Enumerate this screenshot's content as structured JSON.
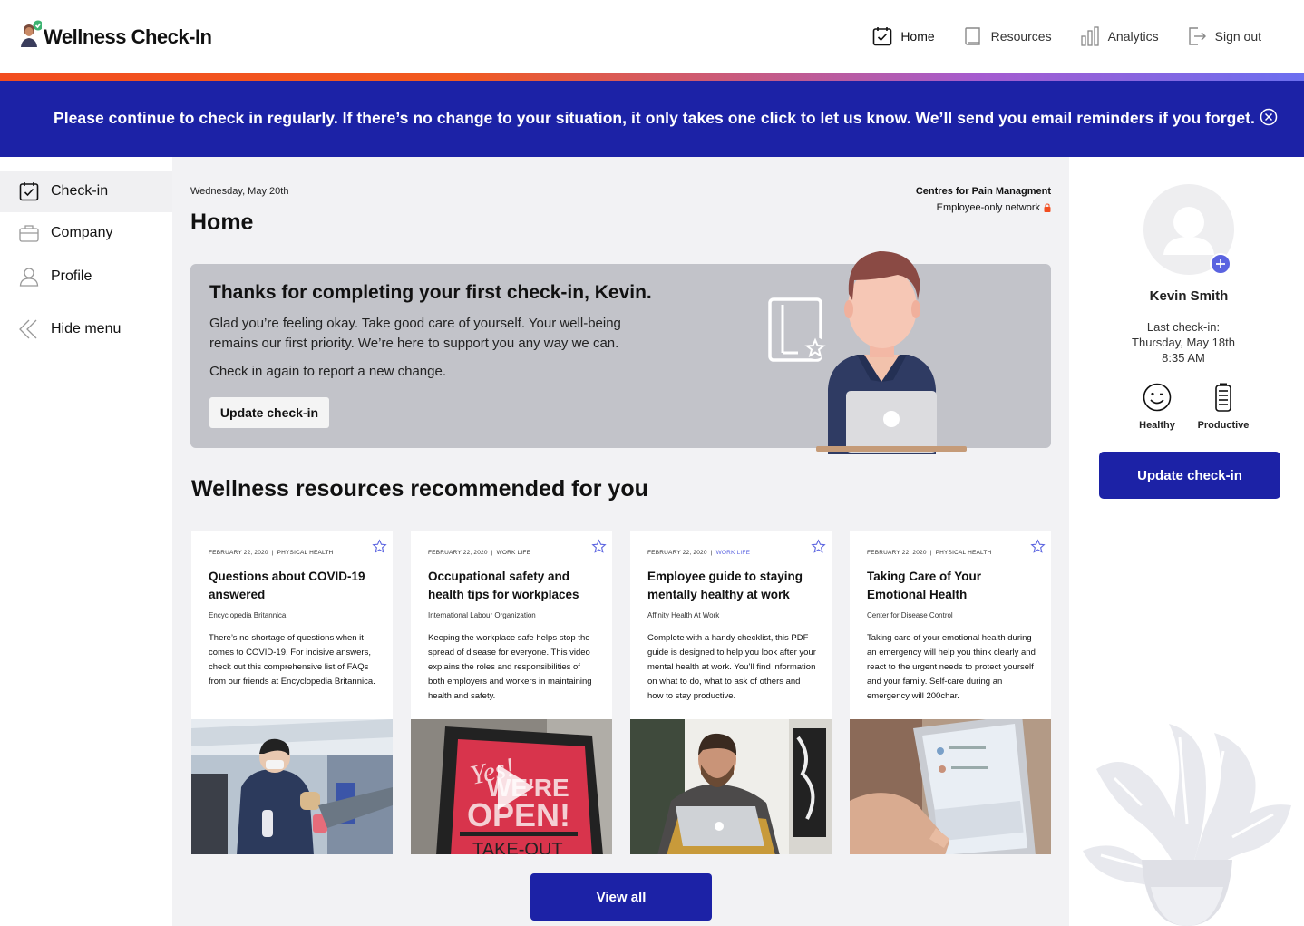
{
  "header": {
    "app_title": "Wellness Check-In",
    "nav": [
      {
        "label": "Home",
        "icon": "calendar-check-icon"
      },
      {
        "label": "Resources",
        "icon": "book-icon"
      },
      {
        "label": "Analytics",
        "icon": "bar-chart-icon"
      },
      {
        "label": "Sign out",
        "icon": "sign-out-icon"
      }
    ]
  },
  "banner": {
    "text": "Please continue to check in regularly. If there’s no change to your situation, it only takes one click to let us know. We’ll send you email reminders if you forget.",
    "color": "#1c22a6"
  },
  "sidebar": {
    "items": [
      {
        "label": "Check-in",
        "icon": "calendar-check-icon"
      },
      {
        "label": "Company",
        "icon": "briefcase-icon"
      },
      {
        "label": "Profile",
        "icon": "user-icon"
      },
      {
        "label": "Hide menu",
        "icon": "double-chevron-left-icon"
      }
    ]
  },
  "main": {
    "date": "Wednesday, May 20th",
    "title": "Home",
    "org_name": "Centres for Pain Managment",
    "network": "Employee-only network",
    "hero": {
      "title": "Thanks for completing your first check-in, Kevin.",
      "text": "Glad you’re feeling okay. Take good care of yourself. Your well-being remains our first priority. We’re here to support you any way we can.",
      "text2": "Check in again to report a new change.",
      "button": "Update check-in"
    },
    "section_title": "Wellness resources recommended for you",
    "cards": [
      {
        "date": "February 22, 2020",
        "tag": "Physical Health",
        "title": "Questions about COVID-19 answered",
        "source": "Encyclopedia Britannica",
        "desc": "There’s no shortage of questions when it comes to COVID-19. For incisive answers, check out this comprehensive list of FAQs from our friends at Encyclopedia Britannica."
      },
      {
        "date": "February 22, 2020",
        "tag": "Work Life",
        "title": "Occupational safety and health tips for workplaces",
        "source": "International Labour Organization",
        "desc": "Keeping the workplace safe helps stop the spread of disease for everyone. This video explains the roles and responsibilities of both employers and workers in maintaining health and safety.",
        "img_text_1": "Yes!",
        "img_text_2": "WE'RE",
        "img_text_3": "OPEN!",
        "img_text_4": "TAKE-OUT"
      },
      {
        "date": "February 22, 2020",
        "tag": "Work Life",
        "title": "Employee guide to staying mentally healthy at work",
        "source": "Affinity Health At Work",
        "desc": "Complete with a handy checklist, this PDF guide is designed to help you look after your mental health at work. You’ll find information on what to do, what to ask of others and how to stay productive."
      },
      {
        "date": "February 22, 2020",
        "tag": "Physical Health",
        "title": "Taking Care of Your Emotional Health",
        "source": "Center for Disease Control",
        "desc": "Taking care of your emotional health during an emergency will help you think clearly and react to the urgent needs to protect yourself and your family. Self-care during an emergency will 200char."
      }
    ],
    "view_all": "View all"
  },
  "profile": {
    "name": "Kevin Smith",
    "last_checkin_label": "Last check-in:",
    "last_checkin_date": "Thursday, May 18th",
    "last_checkin_time": "8:35 AM",
    "status": [
      {
        "label": "Healthy",
        "icon": "smile-icon"
      },
      {
        "label": "Productive",
        "icon": "battery-icon"
      }
    ],
    "button": "Update check-in"
  },
  "colors": {
    "primary": "#1c22a6",
    "accent": "#5a63e0",
    "hero_bg": "#c2c3c9"
  }
}
